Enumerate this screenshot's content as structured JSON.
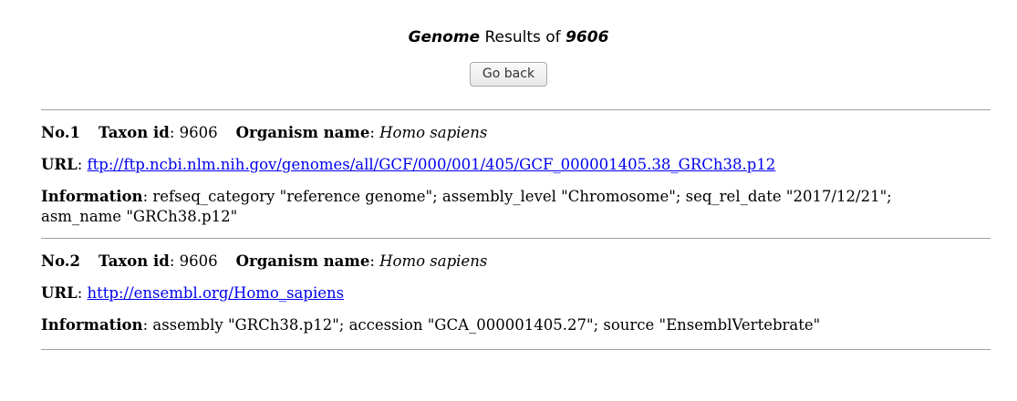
{
  "header": {
    "title_db": "Genome",
    "title_mid": " Results of ",
    "title_taxon": "9606",
    "back_label": "Go back"
  },
  "labels": {
    "no": "No.",
    "taxon_id": "Taxon id",
    "organism_name": "Organism name",
    "url": "URL",
    "information": "Information",
    "sep": ": "
  },
  "results": [
    {
      "no": "1",
      "taxon_id": "9606",
      "organism": "Homo sapiens",
      "url": "ftp://ftp.ncbi.nlm.nih.gov/genomes/all/GCF/000/001/405/GCF_000001405.38_GRCh38.p12",
      "information": "refseq_category \"reference genome\"; assembly_level \"Chromosome\"; seq_rel_date \"2017/12/21\"; asm_name \"GRCh38.p12\""
    },
    {
      "no": "2",
      "taxon_id": "9606",
      "organism": "Homo sapiens",
      "url": "http://ensembl.org/Homo_sapiens",
      "information": "assembly \"GRCh38.p12\"; accession \"GCA_000001405.27\"; source \"EnsemblVertebrate\""
    }
  ]
}
